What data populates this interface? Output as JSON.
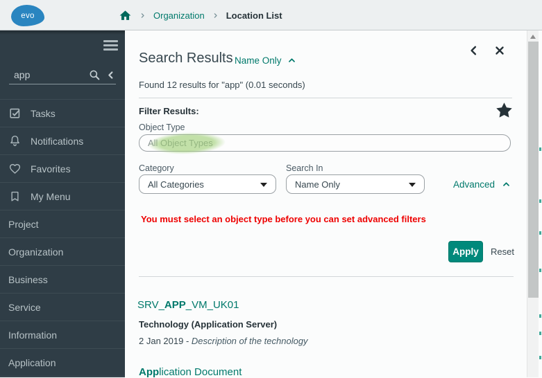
{
  "colors": {
    "accent_teal": "#00796b",
    "apply_button_teal": "#00897b",
    "warning_red": "#ee0000",
    "highlight_green": "#9acd70",
    "sidebar_bg": "#2f3d46",
    "logo_blue": "#2a85c0",
    "topbar_bg": "#edf0f1"
  },
  "icons": [
    "evo-logo",
    "home-icon",
    "breadcrumb-chevron-icon",
    "hamburger-icon",
    "search-icon",
    "collapse-left-icon",
    "tasks-icon",
    "notifications-bell-icon",
    "favorites-heart-icon",
    "my-menu-bookmark-icon",
    "chevron-up-icon",
    "back-icon",
    "close-icon",
    "favorite-star-icon",
    "dropdown-arrow-icon"
  ],
  "topbar": {
    "logo_text": "evo",
    "breadcrumb": [
      "Organization",
      "Location List"
    ]
  },
  "sidebar": {
    "search_value": "app",
    "items": [
      {
        "label": "Tasks",
        "icon": "tasks-icon"
      },
      {
        "label": "Notifications",
        "icon": "notifications-bell-icon"
      },
      {
        "label": "Favorites",
        "icon": "favorites-heart-icon"
      },
      {
        "label": "My Menu",
        "icon": "my-menu-bookmark-icon"
      },
      {
        "label": "Project"
      },
      {
        "label": "Organization"
      },
      {
        "label": "Business"
      },
      {
        "label": "Service"
      },
      {
        "label": "Information"
      },
      {
        "label": "Application"
      }
    ]
  },
  "main": {
    "title": "Search Results",
    "scope": "Name Only",
    "summary": "Found 12 results for \"app\" (0.01 seconds)",
    "filter": {
      "heading": "Filter Results:",
      "object_type_label": "Object Type",
      "object_type_value": "All Object Types",
      "category_label": "Category",
      "category_value": "All Categories",
      "search_in_label": "Search In",
      "search_in_value": "Name Only",
      "advanced_label": "Advanced",
      "warning": "You must select an object type before you can set advanced filters",
      "apply_label": "Apply",
      "reset_label": "Reset"
    },
    "results": [
      {
        "name_pre": "SRV_",
        "name_match": "APP",
        "name_post": "_VM_UK01",
        "type": "Technology (Application Server)",
        "date": "2 Jan 2019 - ",
        "description": "Description of the technology"
      },
      {
        "name_match": "App",
        "name_post": "lication Document"
      }
    ]
  }
}
